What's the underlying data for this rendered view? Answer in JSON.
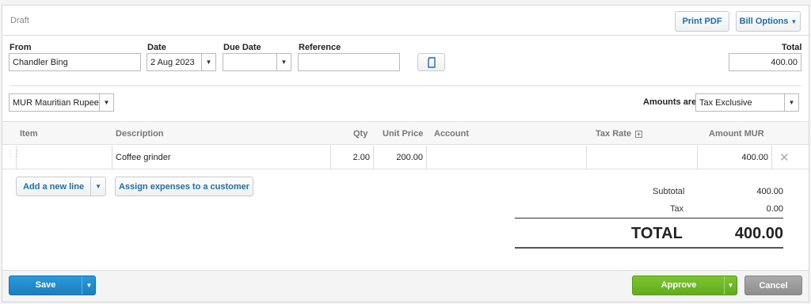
{
  "status": "Draft",
  "print_pdf": "Print PDF",
  "bill_options": "Bill Options",
  "labels": {
    "from": "From",
    "date": "Date",
    "due_date": "Due Date",
    "reference": "Reference",
    "total": "Total",
    "amounts_are": "Amounts are"
  },
  "fields": {
    "from": "Chandler Bing",
    "date": "2 Aug 2023",
    "due_date": "",
    "reference": "",
    "total": "400.00",
    "currency": "MUR Mauritian Rupee",
    "amounts_are": "Tax Exclusive"
  },
  "columns": {
    "item": "Item",
    "description": "Description",
    "qty": "Qty",
    "unit_price": "Unit Price",
    "account": "Account",
    "tax_rate": "Tax Rate",
    "amount": "Amount MUR"
  },
  "rows": [
    {
      "item": "",
      "description": "Coffee grinder",
      "qty": "2.00",
      "unit_price": "200.00",
      "account": "",
      "tax_rate": "",
      "amount": "400.00"
    }
  ],
  "actions": {
    "add_line": "Add a new line",
    "assign": "Assign expenses to a customer"
  },
  "summary": {
    "subtotal_label": "Subtotal",
    "subtotal": "400.00",
    "tax_label": "Tax",
    "tax": "0.00",
    "total_label": "TOTAL",
    "total": "400.00"
  },
  "footer": {
    "save": "Save",
    "approve": "Approve",
    "cancel": "Cancel"
  },
  "colors": {
    "link_blue": "#1d6fb4",
    "save_blue": "#1b7ec2",
    "approve_green": "#62ad1d",
    "cancel_grey": "#8e8e8e"
  }
}
